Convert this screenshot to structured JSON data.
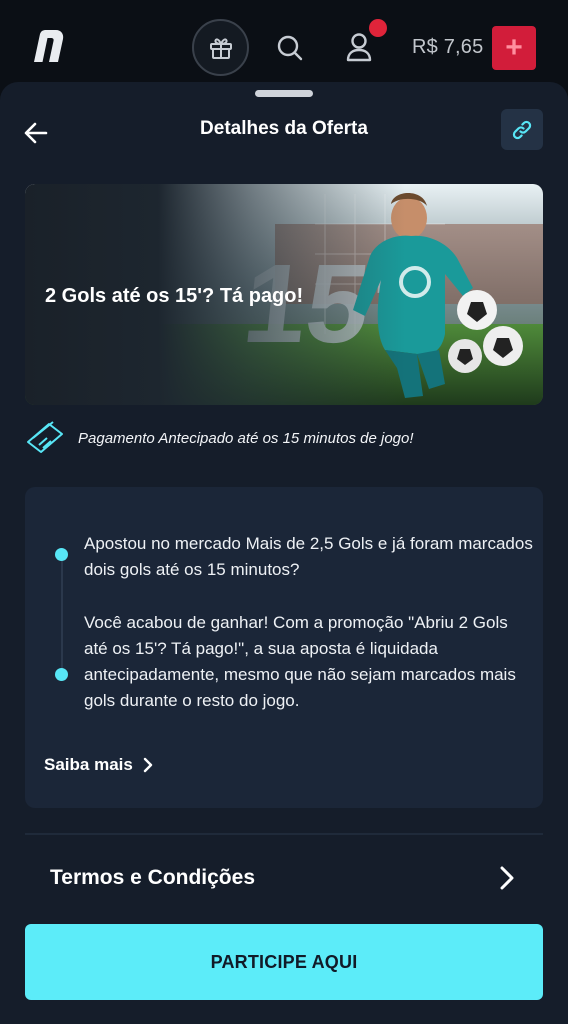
{
  "header": {
    "balance": "R$ 7,65",
    "deposit_label": "+",
    "logo_icon": "brand-logo-icon",
    "icons": [
      "gift-icon",
      "search-icon",
      "user-icon"
    ],
    "notification_color": "#e0243a"
  },
  "sheet": {
    "title": "Detalhes da Oferta",
    "back_icon": "arrow-left-icon",
    "share_icon": "link-icon"
  },
  "banner": {
    "headline": "2 Gols até os 15'?  Tá pago!",
    "graphic_text": "15'"
  },
  "promo": {
    "icon": "ticket-icon",
    "text": "Pagamento Antecipado até os 15 minutos de jogo!"
  },
  "info": {
    "paragraph_1": "Apostou no mercado Mais de 2,5 Gols e já foram marcados dois gols até os 15 minutos?",
    "paragraph_2": "Você acabou de ganhar! Com a promoção \"Abriu 2 Gols até os 15'?  Tá pago!\", a sua aposta é liquidada antecipadamente, mesmo que não sejam marcados mais gols durante o resto do jogo.",
    "more_link": "Saiba mais",
    "accent_color": "#58e6f6"
  },
  "terms": {
    "label": "Termos e Condições"
  },
  "cta": {
    "label": "PARTICIPE AQUI",
    "color": "#5cecf9"
  }
}
